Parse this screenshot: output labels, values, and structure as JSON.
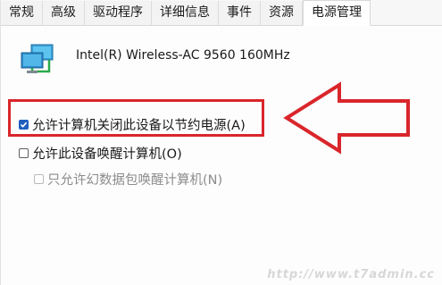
{
  "tabs": [
    {
      "label": "常规",
      "active": false
    },
    {
      "label": "高级",
      "active": false
    },
    {
      "label": "驱动程序",
      "active": false
    },
    {
      "label": "详细信息",
      "active": false
    },
    {
      "label": "事件",
      "active": false
    },
    {
      "label": "资源",
      "active": false
    },
    {
      "label": "电源管理",
      "active": true
    }
  ],
  "device": {
    "icon": "network-adapter-icon",
    "name": "Intel(R) Wireless-AC 9560 160MHz"
  },
  "power_options": [
    {
      "label": "允许计算机关闭此设备以节约电源(A)",
      "checked": true,
      "enabled": true
    },
    {
      "label": "允许此设备唤醒计算机(O)",
      "checked": false,
      "enabled": true
    },
    {
      "label": "只允许幻数据包唤醒计算机(N)",
      "checked": false,
      "enabled": false
    }
  ],
  "annotation": {
    "box_color": "#d9262b",
    "arrow_color": "#d9262b"
  },
  "watermark": "http://www.t7admin.cc"
}
